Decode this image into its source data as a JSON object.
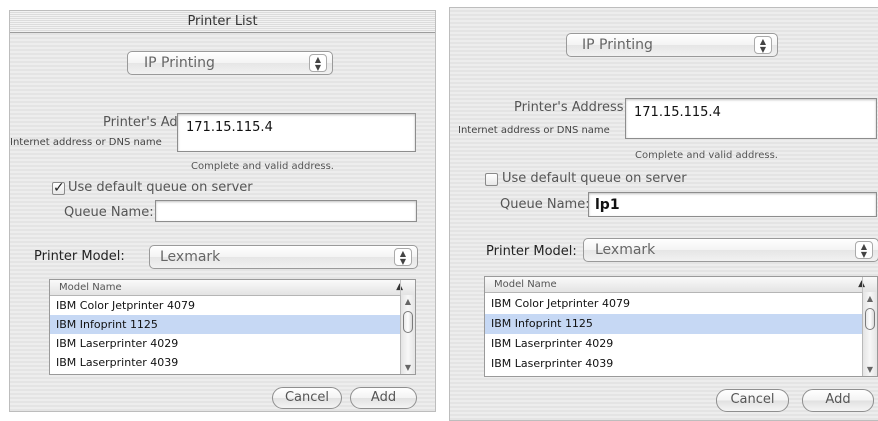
{
  "left": {
    "title": "Printer List",
    "connection_popup": "IP Printing",
    "address_label": "Printer's Address:",
    "address_sublabel": "Internet address or DNS name",
    "address_value": "171.15.115.4",
    "address_status": "Complete and valid address.",
    "default_queue_label": "Use default queue on server",
    "default_queue_checked": true,
    "queue_label": "Queue Name:",
    "queue_value": "",
    "model_label": "Printer Model:",
    "model_popup": "Lexmark",
    "list_header": "Model Name",
    "models": [
      "IBM Color Jetprinter 4079",
      "IBM Infoprint 1125",
      "IBM Laserprinter 4029",
      "IBM Laserprinter 4039"
    ],
    "selected_model": "IBM Infoprint 1125",
    "cancel_label": "Cancel",
    "add_label": "Add"
  },
  "right": {
    "connection_popup": "IP Printing",
    "address_label": "Printer's Address:",
    "address_sublabel": "Internet address or DNS name",
    "address_value": "171.15.115.4",
    "address_status": "Complete and valid address.",
    "default_queue_label": "Use default queue on server",
    "default_queue_checked": false,
    "queue_label": "Queue Name:",
    "queue_value": "lp1",
    "model_label": "Printer Model:",
    "model_popup": "Lexmark",
    "list_header": "Model Name",
    "models": [
      "IBM Color Jetprinter 4079",
      "IBM Infoprint 1125",
      "IBM Laserprinter 4029",
      "IBM Laserprinter 4039"
    ],
    "selected_model": "IBM Infoprint 1125",
    "cancel_label": "Cancel",
    "add_label": "Add"
  },
  "icons": {
    "checkmark": "checkmark-icon",
    "popup_arrows": "updown-arrows-icon",
    "sort": "sort-ascending-icon",
    "scroll_up": "scroll-up-icon",
    "scroll_down": "scroll-down-icon"
  },
  "colors": {
    "selection": "#c6d8f4",
    "panel_stripe_light": "#ededed",
    "panel_stripe_dark": "#e4e4e4"
  }
}
